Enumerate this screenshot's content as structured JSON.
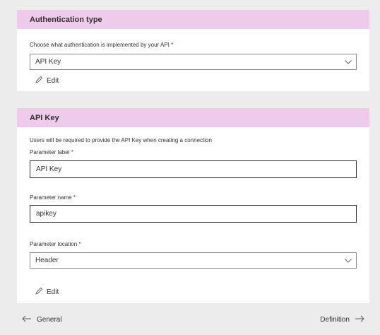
{
  "auth_card": {
    "title": "Authentication type",
    "help_text": "Choose what authentication is implemented by your API",
    "required_mark": "*",
    "selected": "API Key",
    "edit_label": "Edit"
  },
  "apikey_card": {
    "title": "API Key",
    "help_text": "Users will be required to provide the API Key when creating a connection",
    "required_mark": "*",
    "param_label": {
      "label": "Parameter label",
      "value": "API Key"
    },
    "param_name": {
      "label": "Parameter name",
      "value": "apikey"
    },
    "param_location": {
      "label": "Parameter location",
      "value": "Header"
    },
    "edit_label": "Edit"
  },
  "footer": {
    "back_label": "General",
    "next_label": "Definition"
  }
}
